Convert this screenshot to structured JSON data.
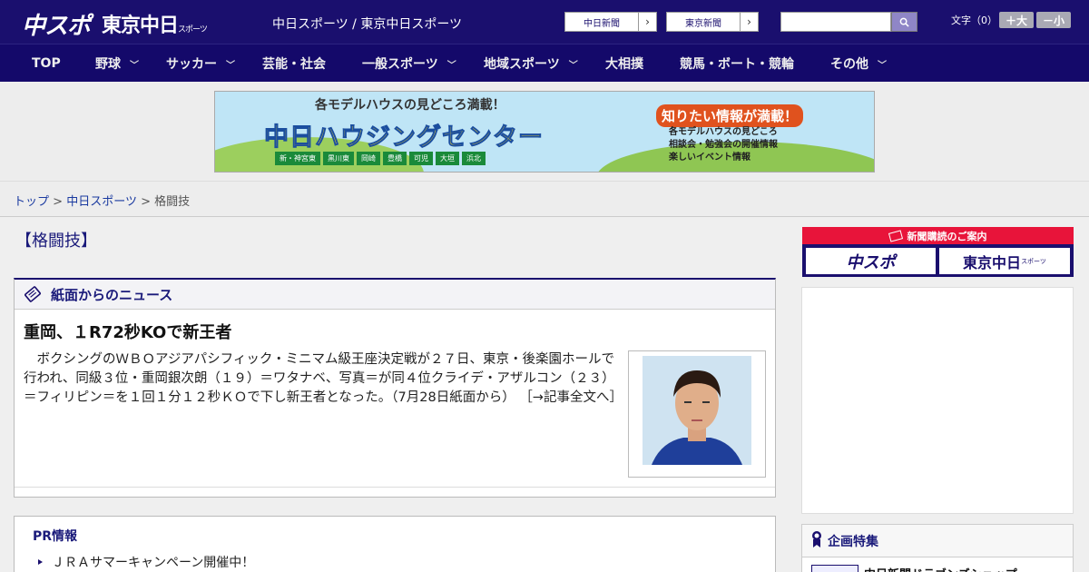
{
  "header": {
    "logo_chuspo": "中スポ",
    "logo_tokyo": "東京中日",
    "logo_tokyo_small": "スポーツ",
    "site_title": "中日スポーツ / 東京中日スポーツ",
    "paper_buttons": [
      "中日新聞",
      "東京新聞"
    ],
    "search": {
      "placeholder": ""
    },
    "font_size_label": "文字（0）",
    "font_larger": "＋大",
    "font_smaller": "－小"
  },
  "nav": [
    {
      "label": "TOP",
      "has_menu": false
    },
    {
      "label": "野球",
      "has_menu": true
    },
    {
      "label": "サッカー",
      "has_menu": true
    },
    {
      "label": "芸能・社会",
      "has_menu": false
    },
    {
      "label": "一般スポーツ",
      "has_menu": true
    },
    {
      "label": "地域スポーツ",
      "has_menu": true
    },
    {
      "label": "大相撲",
      "has_menu": false
    },
    {
      "label": "競馬・ボート・競輪",
      "has_menu": false
    },
    {
      "label": "その他",
      "has_menu": true
    }
  ],
  "banner": {
    "top_text": "各モデルハウスの見どころ満載！",
    "main_text": "中日ハウジングセンター",
    "cities": [
      "新・神宮東",
      "黒川東",
      "岡崎",
      "豊橋",
      "可児",
      "大垣",
      "浜北"
    ],
    "right_title": "知りたい情報が満載！",
    "right_lines": [
      "各モデルハウスの見どころ",
      "相談会・勉強会の開催情報",
      "楽しいイベント情報"
    ]
  },
  "breadcrumb": {
    "home": "トップ",
    "section": "中日スポーツ",
    "current": "格闘技",
    "separator": ">"
  },
  "main": {
    "heading": "【格闘技】",
    "news_section_title": "紙面からのニュース",
    "article": {
      "title": "重岡、１R72秒KOで新王者",
      "body": "　ボクシングのＷＢＯアジアパシフィック・ミニマム級王座決定戦が２７日、東京・後楽園ホールで行われ、同級３位・重岡銀次朗（１９）＝ワタナベ、写真＝が同４位クライデ・アザルコン（２３）＝フィリピン＝を１回１分１２秒ＫＯで下し新王者となった。（7月28日紙面から）",
      "more_link": "［→記事全文へ］"
    },
    "pr": {
      "title": "PR情報",
      "items": [
        "ＪＲＡサマーキャンペーン開催中！"
      ]
    }
  },
  "sidebar": {
    "subscription_title": "新聞購読のご案内",
    "sub_logos": [
      "中スポ",
      "東京中日"
    ],
    "sub_logo_small": "スポーツ",
    "kikaku_title": "企画特集",
    "kikaku_items": [
      "中日新聞ドラゴンズショップ"
    ]
  },
  "colors": {
    "header_bg": "#1a0f6e",
    "nav_bg": "#14096a",
    "accent_red": "#e8143a",
    "link": "#1a3aa0"
  }
}
